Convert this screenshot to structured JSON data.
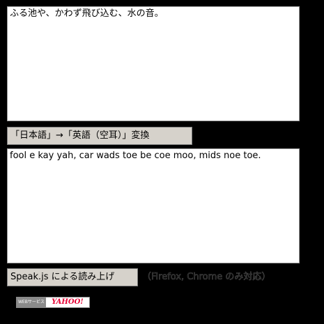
{
  "source_text": "ふる池や、かわず飛び込む、水の音。",
  "convert_button_label": "「日本語」→「英語（空耳）」変換",
  "output_text": "fool e kay yah, car wads toe be coe moo, mids noe toe.",
  "speak_button_label": "Speak.js による読み上げ",
  "speak_note": "（Firefox, Chrome のみ対応）",
  "badge": {
    "service_text": "WEBサービス",
    "brand_text": "YAHOO!"
  }
}
